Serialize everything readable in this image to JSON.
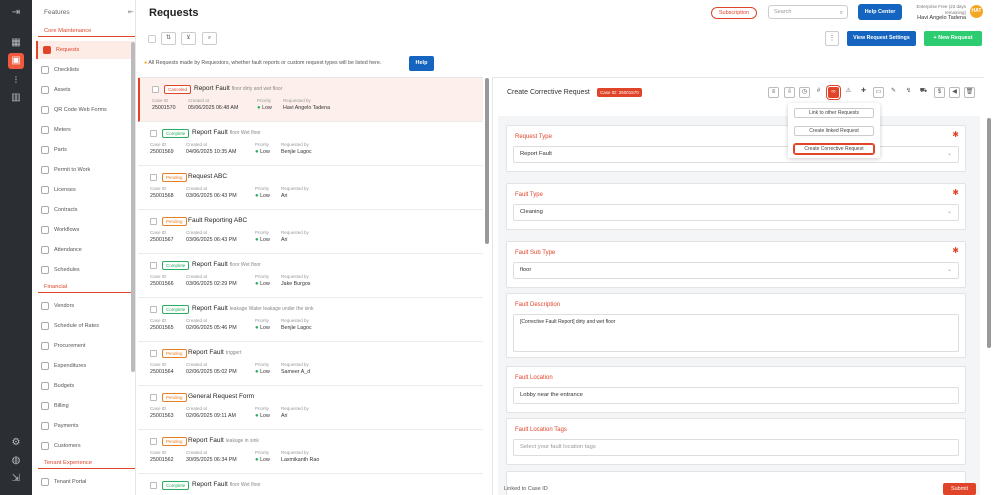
{
  "sidebar": {
    "features_label": "Features",
    "sections": {
      "core": "Core Maintenance",
      "financial": "Financial",
      "tenant": "Tenant Experience"
    },
    "core_items": [
      "Requests",
      "Checklists",
      "Assets",
      "QR Code Web Forms",
      "Meters",
      "Parts",
      "Permit to Work",
      "Licenses",
      "Contracts",
      "Workflows",
      "Attendance",
      "Schedules"
    ],
    "financial_items": [
      "Vendors",
      "Schedule of Rates",
      "Procurement",
      "Expenditures",
      "Budgets",
      "Billing",
      "Payments",
      "Customers"
    ],
    "tenant_items": [
      "Tenant Portal"
    ]
  },
  "header": {
    "title": "Requests",
    "subscription": "Subscription",
    "search_placeholder": "Search",
    "help_center": "Help Center",
    "enterprise": "Enterprise Free (23 days remaining)",
    "user_name": "Havi Angelo Tadena",
    "avatar_initials": "HAT"
  },
  "toolbar": {
    "view_settings": "View Request Settings",
    "new_request": "+ New Request",
    "kebab": "⋮"
  },
  "info": {
    "text": "All Requests made by Requestors, whether fault reports or custom request types will be listed here.",
    "help": "Help"
  },
  "list_labels": {
    "case": "Case ID",
    "created": "Created at",
    "priority": "Priority",
    "requested": "Requested by"
  },
  "requests": [
    {
      "status": "Canceled",
      "title": "Report Fault",
      "sub": "floor dirty and wet floor",
      "case": "25001570",
      "created": "05/06/2025 06:48 AM",
      "priority": "Low",
      "by": "Havi Angelo Tadena"
    },
    {
      "status": "Complete",
      "title": "Report Fault",
      "sub": "floor Wet floor",
      "case": "25001569",
      "created": "04/06/2025 10:35 AM",
      "priority": "Low",
      "by": "Benjie Lagoc"
    },
    {
      "status": "Pending",
      "title": "Request ABC",
      "sub": "",
      "case": "25001568",
      "created": "03/06/2025 06:43 PM",
      "priority": "Low",
      "by": "Ari"
    },
    {
      "status": "Pending",
      "title": "Fault Reporting ABC",
      "sub": "",
      "case": "25001567",
      "created": "03/06/2025 06:43 PM",
      "priority": "Low",
      "by": "Ari"
    },
    {
      "status": "Complete",
      "title": "Report Fault",
      "sub": "floor Wet floor",
      "case": "25001566",
      "created": "03/06/2025 02:29 PM",
      "priority": "Low",
      "by": "Jake Burgos"
    },
    {
      "status": "Complete",
      "title": "Report Fault",
      "sub": "leakage Water leakage under the sink",
      "case": "25001565",
      "created": "02/06/2025 05:46 PM",
      "priority": "Low",
      "by": "Benjie Lagoc"
    },
    {
      "status": "Pending",
      "title": "Report Fault",
      "sub": "triggert",
      "case": "25001564",
      "created": "02/06/2025 05:02 PM",
      "priority": "Low",
      "by": "Sameer A_d"
    },
    {
      "status": "Pending",
      "title": "General Request Form",
      "sub": "",
      "case": "25001563",
      "created": "02/06/2025 09:11 AM",
      "priority": "Low",
      "by": "Ari"
    },
    {
      "status": "Pending",
      "title": "Report Fault",
      "sub": "leakage in sink",
      "case": "25001562",
      "created": "30/05/2025 06:34 PM",
      "priority": "Low",
      "by": "Laxmikanth Rao"
    },
    {
      "status": "Complete",
      "title": "Report Fault",
      "sub": "floor Wet floor",
      "case": "",
      "created": "",
      "priority": "",
      "by": ""
    }
  ],
  "detail": {
    "title": "Create Corrective Request",
    "case_badge": "Case ID: 25001570",
    "dropdown": [
      "Link to other Requests",
      "Create linked Request",
      "Create Corrective Request"
    ],
    "fields": {
      "request_type": {
        "label": "Request Type",
        "value": "Report Fault"
      },
      "fault_type": {
        "label": "Fault Type",
        "value": "Cleaning"
      },
      "fault_sub_type": {
        "label": "Fault Sub Type",
        "value": "floor"
      },
      "fault_description": {
        "label": "Fault Description",
        "value": "[Corrective Fault Report] dirty and wet floor"
      },
      "fault_location": {
        "label": "Fault Location",
        "value": "Lobby near the entrance"
      },
      "fault_location_tags": {
        "label": "Fault Location Tags",
        "placeholder": "Select your fault location tags"
      }
    },
    "linked_label": "Linked to Case ID",
    "submit": "Submit"
  },
  "colors": {
    "accent": "#e0452a",
    "primary": "#1565c0",
    "success": "#2ecc71"
  }
}
